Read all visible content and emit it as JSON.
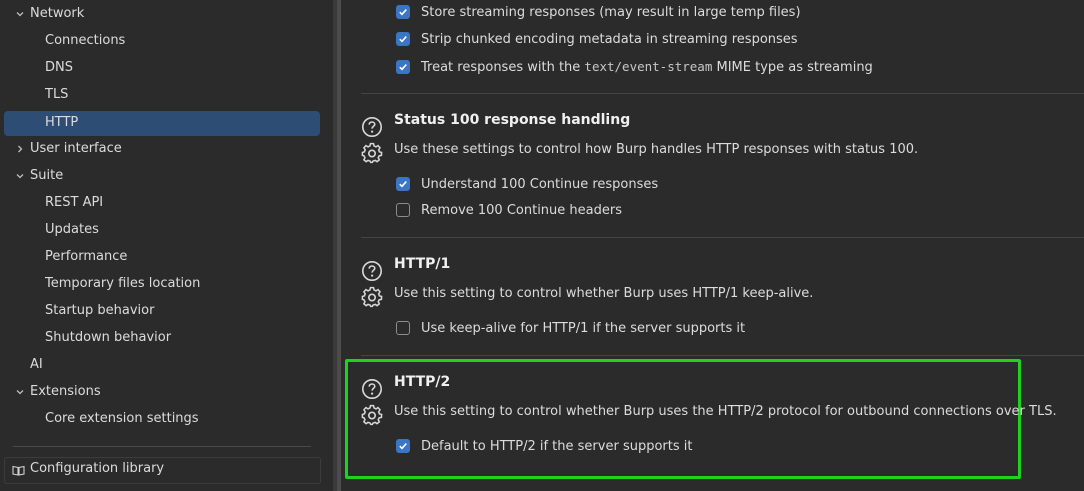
{
  "sidebar": {
    "items": [
      {
        "label": "Network",
        "level": 1,
        "expanded": true
      },
      {
        "label": "Connections",
        "level": 2
      },
      {
        "label": "DNS",
        "level": 2
      },
      {
        "label": "TLS",
        "level": 2
      },
      {
        "label": "HTTP",
        "level": 2,
        "selected": true
      },
      {
        "label": "User interface",
        "level": 1,
        "expanded": false
      },
      {
        "label": "Suite",
        "level": 1,
        "expanded": true
      },
      {
        "label": "REST API",
        "level": 2
      },
      {
        "label": "Updates",
        "level": 2
      },
      {
        "label": "Performance",
        "level": 2
      },
      {
        "label": "Temporary files location",
        "level": 2
      },
      {
        "label": "Startup behavior",
        "level": 2
      },
      {
        "label": "Shutdown behavior",
        "level": 2
      },
      {
        "label": "AI",
        "level": 1
      },
      {
        "label": "Extensions",
        "level": 1,
        "expanded": true
      },
      {
        "label": "Core extension settings",
        "level": 2
      }
    ],
    "config_library_label": "Configuration library"
  },
  "streaming": {
    "options": [
      {
        "label": "Store streaming responses (may result in large temp files)",
        "checked": true
      },
      {
        "label": "Strip chunked encoding metadata in streaming responses",
        "checked": true
      },
      {
        "label_before": "Treat responses with the ",
        "code": "text/event-stream",
        "label_after": " MIME type as streaming",
        "checked": true
      }
    ]
  },
  "status100": {
    "title": "Status 100 response handling",
    "description": "Use these settings to control how Burp handles HTTP responses with status 100.",
    "options": [
      {
        "label": "Understand 100 Continue responses",
        "checked": true
      },
      {
        "label": "Remove 100 Continue headers",
        "checked": false
      }
    ]
  },
  "http1": {
    "title": "HTTP/1",
    "description": "Use this setting to control whether Burp uses HTTP/1 keep-alive.",
    "options": [
      {
        "label": "Use keep-alive for HTTP/1 if the server supports it",
        "checked": false
      }
    ]
  },
  "http2": {
    "title": "HTTP/2",
    "description": "Use this setting to control whether Burp uses the HTTP/2 protocol for outbound connections over TLS.",
    "options": [
      {
        "label": "Default to HTTP/2 if the server supports it",
        "checked": true
      }
    ]
  },
  "colors": {
    "selected_row": "#2e4d75",
    "checkbox_checked": "#3a76c4",
    "highlight_border": "#1ed31e"
  }
}
